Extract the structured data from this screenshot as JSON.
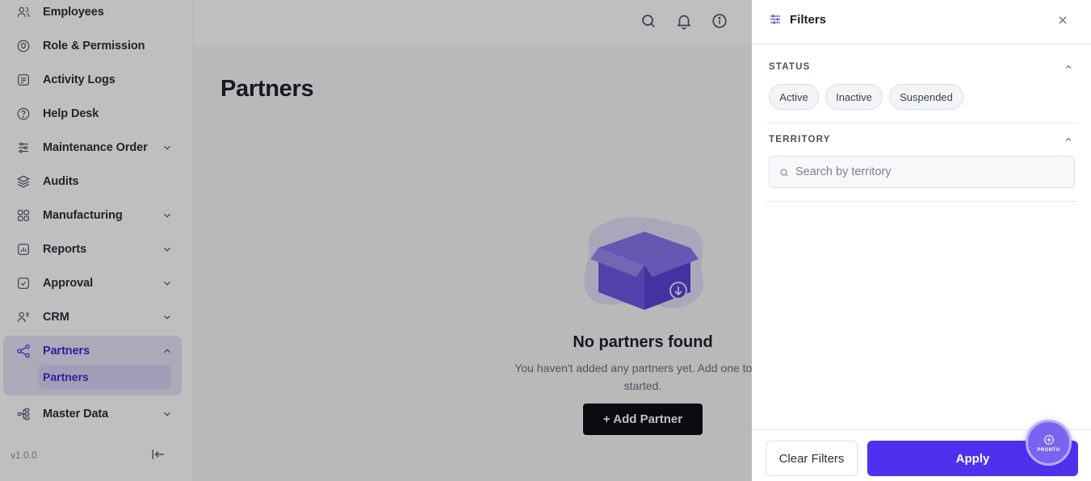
{
  "sidebar": {
    "items": [
      {
        "label": "Employees",
        "icon": "users-icon"
      },
      {
        "label": "Role & Permission",
        "icon": "shield-icon"
      },
      {
        "label": "Activity Logs",
        "icon": "list-icon"
      },
      {
        "label": "Help Desk",
        "icon": "help-circle-icon"
      },
      {
        "label": "Maintenance Order",
        "icon": "sliders-icon"
      },
      {
        "label": "Audits",
        "icon": "layers-icon"
      },
      {
        "label": "Manufacturing",
        "icon": "grid-icon"
      },
      {
        "label": "Reports",
        "icon": "report-icon"
      },
      {
        "label": "Approval",
        "icon": "check-square-icon"
      },
      {
        "label": "CRM",
        "icon": "user-group-icon"
      },
      {
        "label": "Partners",
        "icon": "share-icon"
      },
      {
        "label": "Master Data",
        "icon": "hierarchy-icon"
      }
    ],
    "sub_item": "Partners",
    "version": "v1.0.0"
  },
  "main": {
    "title": "Partners",
    "empty_title": "No partners found",
    "empty_description": "You haven't added any partners yet. Add one to get started.",
    "add_button": "+ Add Partner"
  },
  "filters": {
    "title": "Filters",
    "status": {
      "label": "STATUS",
      "options": [
        "Active",
        "Inactive",
        "Suspended"
      ]
    },
    "territory": {
      "label": "TERRITORY",
      "placeholder": "Search by territory"
    },
    "clear_label": "Clear Filters",
    "apply_label": "Apply"
  },
  "fab": {
    "label": "PRONTO"
  },
  "colors": {
    "accent": "#4f30ee",
    "active_bg": "#e6e2f7",
    "button_dark": "#0d0f14"
  }
}
